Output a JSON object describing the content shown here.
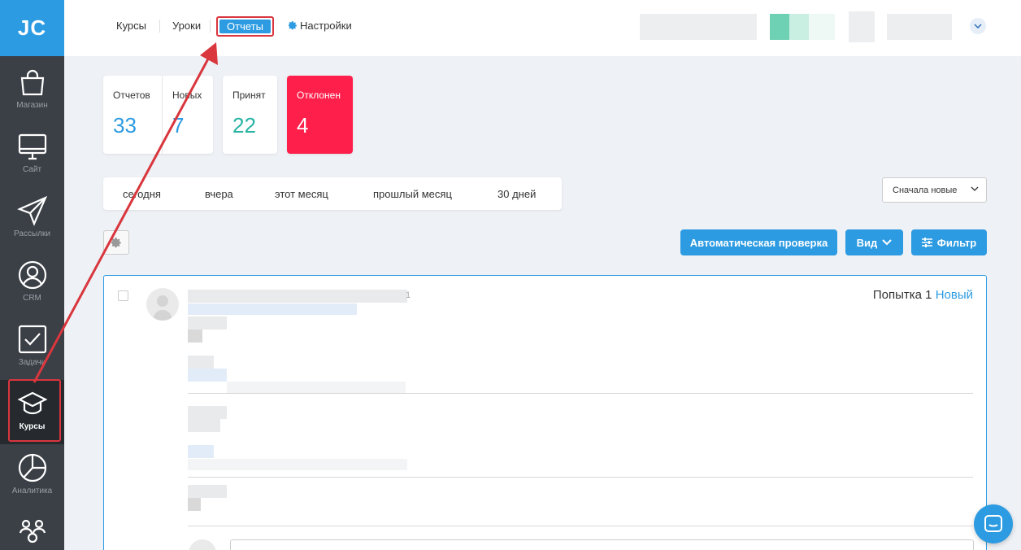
{
  "logo": "JC",
  "sidebar": {
    "items": [
      {
        "label": "Магазин",
        "icon": "shopping-bag-icon"
      },
      {
        "label": "Сайт",
        "icon": "monitor-icon"
      },
      {
        "label": "Рассылки",
        "icon": "paper-plane-icon"
      },
      {
        "label": "CRM",
        "icon": "user-circle-icon"
      },
      {
        "label": "Задачи",
        "icon": "checkbox-icon"
      },
      {
        "label": "Курсы",
        "icon": "graduation-cap-icon",
        "active": true
      },
      {
        "label": "Аналитика",
        "icon": "pie-chart-icon"
      },
      {
        "label": "",
        "icon": "people-icon"
      }
    ]
  },
  "topnav": {
    "tabs": [
      "Курсы",
      "Уроки",
      "Отчеты",
      "Настройки"
    ],
    "active_tab": "Отчеты"
  },
  "stats": {
    "reports_label": "Отчетов",
    "reports_value": "33",
    "new_label": "Новых",
    "new_value": "7",
    "accepted_label": "Принят",
    "accepted_value": "22",
    "rejected_label": "Отклонен",
    "rejected_value": "4"
  },
  "date_filters": [
    "сегодня",
    "вчера",
    "этот месяц",
    "прошлый месяц",
    "30 дней"
  ],
  "sort": {
    "selected": "Сначала новые"
  },
  "actions": {
    "auto_check": "Автоматическая проверка",
    "view": "Вид",
    "filter": "Фильтр"
  },
  "report": {
    "attempt_label": "Попытка 1",
    "status": "Новый",
    "fragment": "1"
  },
  "colors": {
    "accent": "#2d9be2",
    "danger": "#ff1f4b",
    "success": "#27b3a2",
    "sidebar": "#3b3f46",
    "highlight": "#d9363e"
  }
}
